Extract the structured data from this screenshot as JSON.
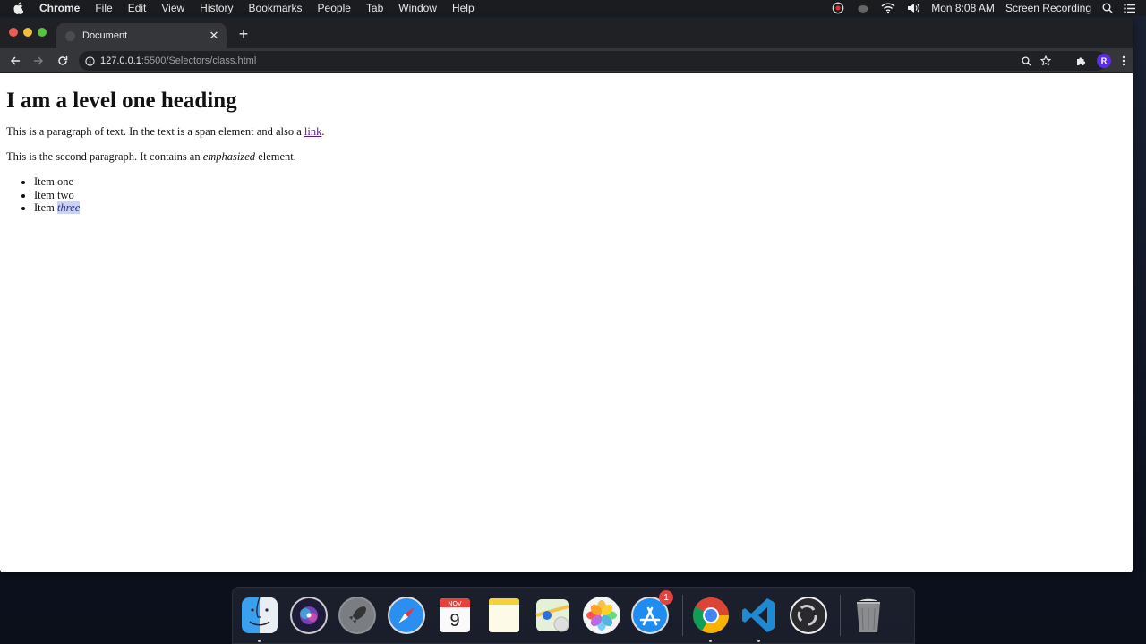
{
  "menubar": {
    "app_name": "Chrome",
    "menus": [
      "File",
      "Edit",
      "View",
      "History",
      "Bookmarks",
      "People",
      "Tab",
      "Window",
      "Help"
    ],
    "clock": "Mon 8:08 AM",
    "screen_recording_label": "Screen Recording",
    "status_icons": [
      "obs-icon",
      "creative-cloud-icon",
      "wifi-icon",
      "volume-icon"
    ]
  },
  "browser": {
    "tab": {
      "title": "Document"
    },
    "new_tab_label": "+",
    "tab_close_label": "✕",
    "url": {
      "host": "127.0.0.1",
      "rest": ":5500/Selectors/class.html"
    },
    "profile_initial": "R"
  },
  "page": {
    "heading": "I am a level one heading",
    "paragraph1": {
      "before_link": "This is a paragraph of text. In the text is a span element and also a ",
      "link_text": "link",
      "after_link": "."
    },
    "paragraph2": {
      "before_em": "This is the second paragraph. It contains an ",
      "em_text": "emphasized",
      "after_em": " element."
    },
    "list_items": [
      {
        "text": "Item one"
      },
      {
        "text": "Item two"
      },
      {
        "prefix": "Item ",
        "selected_text": "three"
      }
    ]
  },
  "dock": {
    "apps": [
      {
        "name": "Finder",
        "running": true
      },
      {
        "name": "Siri",
        "running": false
      },
      {
        "name": "Launchpad",
        "running": false
      },
      {
        "name": "Safari",
        "running": false
      },
      {
        "name": "Calendar",
        "running": false,
        "month": "NOV",
        "day": "9"
      },
      {
        "name": "Notes",
        "running": false
      },
      {
        "name": "Maps",
        "running": false
      },
      {
        "name": "Photos",
        "running": false
      },
      {
        "name": "App Store",
        "running": false,
        "badge": "1"
      },
      {
        "name": "Google Chrome",
        "running": true
      },
      {
        "name": "Visual Studio Code",
        "running": true
      },
      {
        "name": "OBS",
        "running": false
      },
      {
        "name": "Trash",
        "running": false
      }
    ]
  }
}
